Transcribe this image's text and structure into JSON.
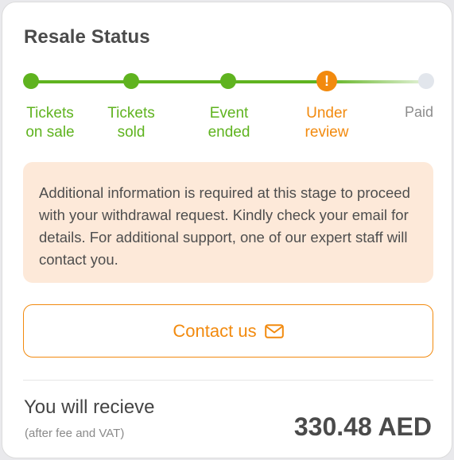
{
  "card": {
    "title": "Resale Status"
  },
  "stepper": {
    "steps": [
      {
        "label": "Tickets\non sale",
        "state": "done"
      },
      {
        "label": "Tickets\nsold",
        "state": "done"
      },
      {
        "label": "Event\nended",
        "state": "done"
      },
      {
        "label": "Under\nreview",
        "state": "warning"
      },
      {
        "label": "Paid",
        "state": "pending"
      }
    ],
    "warning_glyph": "!",
    "colors": {
      "done": "#5fb31f",
      "warning": "#f28a0e",
      "pending": "#e2e6ec"
    }
  },
  "notice": {
    "text": "Additional information is required at this stage to proceed with your withdrawal request. Kindly check your email for details. For additional support, one of our expert staff will contact you."
  },
  "contact": {
    "label": "Contact us",
    "icon": "mail-icon"
  },
  "payout": {
    "label": "You will recieve",
    "sublabel": "(after fee and VAT)",
    "amount": "330.48 AED"
  }
}
